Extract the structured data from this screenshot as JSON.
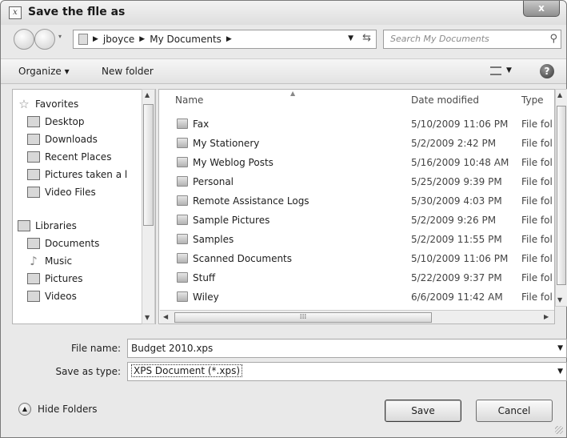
{
  "window": {
    "title": "Save the flle as",
    "close_label": "x"
  },
  "address": {
    "crumbs": [
      "jboyce",
      "My Documents"
    ]
  },
  "search": {
    "placeholder": "Search My Documents"
  },
  "toolbar": {
    "organize_label": "Organize ▾",
    "new_folder_label": "New folder",
    "help_glyph": "?"
  },
  "navpane": {
    "favorites_label": "Favorites",
    "favorites": [
      "Desktop",
      "Downloads",
      "Recent Places",
      "Pictures taken a l",
      "Video Files"
    ],
    "libraries_label": "Libraries",
    "libraries": [
      "Documents",
      "Music",
      "Pictures",
      "Videos"
    ]
  },
  "filelist": {
    "columns": [
      "Name",
      "Date modified",
      "Type"
    ],
    "rows": [
      {
        "name": "Fax",
        "date": "5/10/2009 11:06 PM",
        "type": "File fol"
      },
      {
        "name": "My Stationery",
        "date": "5/2/2009 2:42 PM",
        "type": "File fol"
      },
      {
        "name": "My Weblog Posts",
        "date": "5/16/2009 10:48 AM",
        "type": "File fol"
      },
      {
        "name": "Personal",
        "date": "5/25/2009 9:39 PM",
        "type": "File fol"
      },
      {
        "name": "Remote Assistance Logs",
        "date": "5/30/2009 4:03 PM",
        "type": "File fol"
      },
      {
        "name": "Sample Pictures",
        "date": "5/2/2009 9:26 PM",
        "type": "File fol"
      },
      {
        "name": "Samples",
        "date": "5/2/2009 11:55 PM",
        "type": "File fol"
      },
      {
        "name": "Scanned Documents",
        "date": "5/10/2009 11:06 PM",
        "type": "File fol"
      },
      {
        "name": "Stuff",
        "date": "5/22/2009 9:37 PM",
        "type": "File fol"
      },
      {
        "name": "Wiley",
        "date": "6/6/2009 11:42 AM",
        "type": "File fol"
      }
    ]
  },
  "form": {
    "file_name_label": "File name:",
    "file_name_value": "Budget 2010.xps",
    "save_type_label": "Save as type:",
    "save_type_value": "XPS Document (*.xps)"
  },
  "footer": {
    "hide_folders_label": "Hide Folders",
    "save_label": "Save",
    "cancel_label": "Cancel"
  }
}
